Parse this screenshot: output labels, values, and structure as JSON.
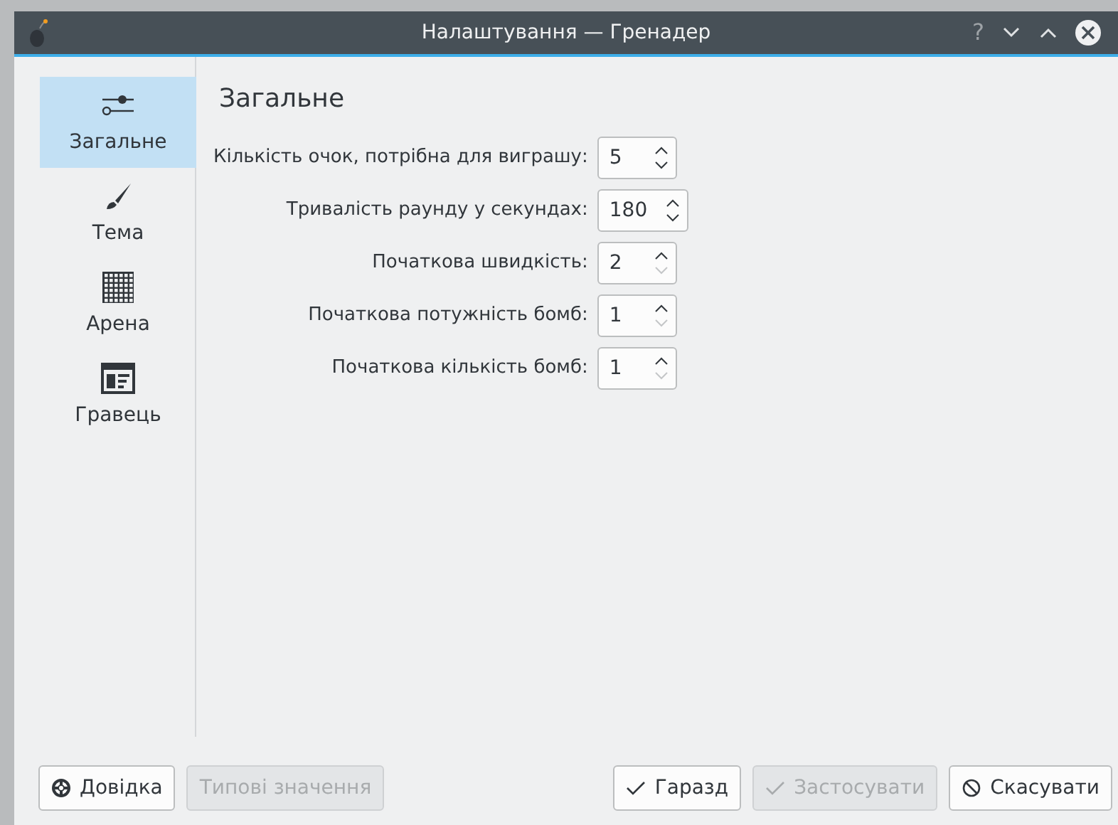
{
  "window": {
    "title": "Налаштування — Гренадер",
    "controls": [
      "?"
    ]
  },
  "sidebar": {
    "items": [
      {
        "label": "Загальне",
        "kind": "sliders",
        "selected": true
      },
      {
        "label": "Тема",
        "kind": "brush",
        "selected": false
      },
      {
        "label": "Арена",
        "kind": "grid",
        "selected": false
      },
      {
        "label": "Гравець",
        "kind": "layout",
        "selected": false
      }
    ]
  },
  "page": {
    "heading": "Загальне",
    "fields": [
      {
        "label": "Кількість очок, потрібна для виграшу:",
        "value": "5",
        "down_disabled": false
      },
      {
        "label": "Тривалість раунду у секундах:",
        "value": "180",
        "down_disabled": false
      },
      {
        "label": "Початкова швидкість:",
        "value": "2",
        "down_disabled": true
      },
      {
        "label": "Початкова потужність бомб:",
        "value": "1",
        "down_disabled": true
      },
      {
        "label": "Початкова кількість бомб:",
        "value": "1",
        "down_disabled": true
      }
    ]
  },
  "buttons_left": [
    {
      "label": "Довідка",
      "kind": "help",
      "disabled": false
    },
    {
      "label": "Типові значення",
      "kind": "none",
      "disabled": true
    }
  ],
  "buttons_right": [
    {
      "label": "Гаразд",
      "kind": "ok",
      "disabled": false
    },
    {
      "label": "Застосувати",
      "kind": "ok",
      "disabled": true
    },
    {
      "label": "Скасувати",
      "kind": "cancel",
      "disabled": false
    }
  ]
}
